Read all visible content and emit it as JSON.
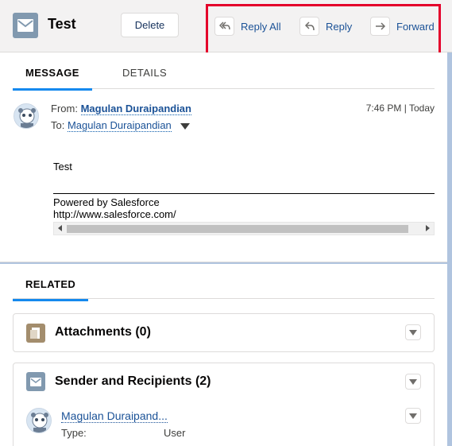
{
  "header": {
    "title": "Test",
    "delete_label": "Delete",
    "actions": [
      {
        "label": "Reply All",
        "icon": "reply-all-icon"
      },
      {
        "label": "Reply",
        "icon": "reply-icon"
      },
      {
        "label": "Forward",
        "icon": "forward-icon"
      }
    ]
  },
  "message": {
    "tabs": [
      "MESSAGE",
      "DETAILS"
    ],
    "from_prefix": "From:",
    "from_name": "Magulan Duraipandian",
    "to_prefix": "To:",
    "to_name": "Magulan Duraipandian",
    "time": "7:46 PM | Today",
    "body": "Test",
    "powered_by": "Powered by Salesforce",
    "url": "http://www.salesforce.com/"
  },
  "related": {
    "tab": "RELATED",
    "attachments_title": "Attachments (0)",
    "recipients_title": "Sender and Recipients (2)",
    "recipient": {
      "name": "Magulan Duraipand...",
      "type_label": "Type:",
      "type_value": "User"
    }
  },
  "colors": {
    "accent": "#1589ee",
    "link": "#1b5297",
    "highlight": "#e4002b",
    "email_icon_bg": "#8199af",
    "attachment_icon_bg": "#a38d6d"
  }
}
